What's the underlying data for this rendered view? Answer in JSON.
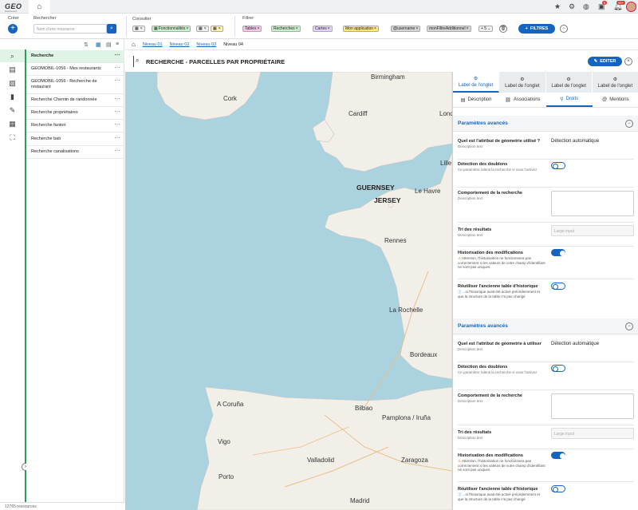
{
  "topbar": {
    "logo": "GEO",
    "logo_sub": "Dashboard",
    "notif_badge": "6",
    "messages_badge": "99+"
  },
  "toolbar": {
    "create_label": "Créer",
    "search_label": "Rechercher",
    "search_placeholder": "Nom d'une ressource",
    "consult_label": "Consulter",
    "filter_label": "Filtrer",
    "consult_chips": [
      {
        "label": "",
        "color": "#f0f0f0"
      },
      {
        "label": "Fonctionnalités",
        "color": "#c8f0c8"
      },
      {
        "label": "",
        "color": "#f0f0f0"
      },
      {
        "label": "",
        "color": "#fff3b0"
      }
    ],
    "filter_chips": [
      {
        "label": "Tables",
        "color": "#f5c6e8"
      },
      {
        "label": "Recherches",
        "color": "#c8f0c8"
      },
      {
        "label": "Cartes",
        "color": "#e3d4f7"
      },
      {
        "label": "Mon application",
        "color": "#ffe680"
      },
      {
        "label": "@username",
        "color": "#d5d5d5"
      },
      {
        "label": "monFiltreAdditionnel",
        "color": "#d5d5d5"
      },
      {
        "label": "+ 5",
        "color": "#eeeeee"
      }
    ],
    "filters_button": "FILTRES"
  },
  "list": {
    "items": [
      {
        "label": "Recherche"
      },
      {
        "label": "GEOMOBIL-1056 - Mes restaurants"
      },
      {
        "label": "GEOMOBIL-1056 - Recherche de restaurant"
      },
      {
        "label": "Recherche Chemin de randonnée"
      },
      {
        "label": "Recherche propriétaires"
      },
      {
        "label": "Recherche fantoir"
      },
      {
        "label": "Recherche bati"
      },
      {
        "label": "Recherche canalisations"
      }
    ],
    "footer": "12765 ressources"
  },
  "breadcrumb": {
    "items": [
      "Niveau 01",
      "Niveau 02",
      "Niveau 03",
      "Niveau 04"
    ]
  },
  "page": {
    "title": "RECHERCHE - PARCELLES PAR PROPRIÉTAIRE",
    "edit_button": "EDITER"
  },
  "map": {
    "cities": [
      "Birmingham",
      "London",
      "Cork",
      "Cardiff",
      "Lille",
      "Le Havre",
      "Rennes",
      "La Rochelle",
      "Bordeaux",
      "A Coruña",
      "Bilbao",
      "Pamplona / Iruña",
      "Vigo",
      "Valladolid",
      "Zaragoza",
      "Porto",
      "Madrid"
    ],
    "islands": [
      "GUERNSEY",
      "JERSEY"
    ]
  },
  "panel": {
    "tabs": [
      "Label de l'onglet",
      "Label de l'onglet",
      "Label de l'onglet",
      "Label de l'onglet"
    ],
    "subtabs": [
      "Description",
      "Associations",
      "Droits",
      "Mentions"
    ],
    "sections": [
      {
        "title": "Paramètres avancés",
        "geom_label": "Quel est l'attribut de géometrie utilisé ?",
        "geom_desc": "Description text",
        "geom_value": "Détection automatique",
        "dup_label": "Détection des doublons",
        "dup_desc": "Ce paramètre ralenti la recherche si vous l'activez",
        "behav_label": "Comportement de la recherche",
        "behav_desc": "Description text",
        "sort_label": "Tri des résultats",
        "sort_desc": "Description text",
        "sort_placeholder": "Large input",
        "hist_label": "Historisation des modifications",
        "hist_warn": "Attention, l'historisation ne fonctionnera pas correctement si les valeurs de votre champ d'identifiant ne sont pas uniques.",
        "reuse_label": "Réutiliser l'ancienne table d'historique",
        "reuse_info": "...si l'historique avait été activé précédemment et que la structure de la table n'a pas changé"
      },
      {
        "title": "Paramètres avancés",
        "geom_label": "Quel est l'attribut de géometrie à utiliser",
        "geom_desc": "Description text",
        "geom_value": "Détection automatique",
        "dup_label": "Détection des doublons",
        "dup_desc": "Ce paramètre ralenti la recherche si vous l'activez",
        "behav_label": "Comportement de la recherche",
        "behav_desc": "Description text",
        "sort_label": "Tri des résultats",
        "sort_desc": "Description text",
        "sort_placeholder": "Large input",
        "hist_label": "Historisation des modifications",
        "hist_warn": "Attention, l'historisation ne fonctionnera pas correctement si les valeurs de votre champ d'identifiant ne sont pas uniques.",
        "reuse_label": "Réutiliser l'ancienne table d'historique",
        "reuse_info": "...si l'historique avait été activé précédemment et que la structure de la table n'a pas changé"
      }
    ]
  }
}
